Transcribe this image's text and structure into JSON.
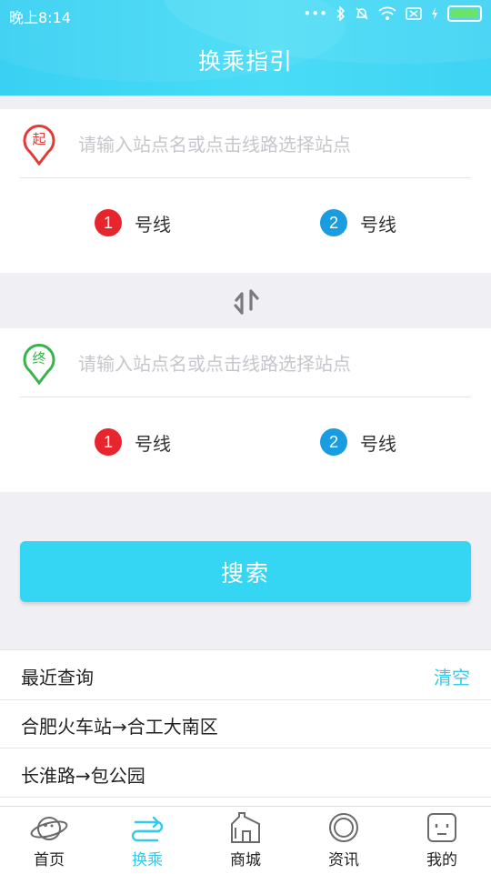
{
  "status_bar": {
    "time": "晚上8:14",
    "icons": [
      "more-icon",
      "bluetooth-icon",
      "mute-icon",
      "wifi-icon",
      "sim-off-icon",
      "charging-icon",
      "battery-icon"
    ]
  },
  "header": {
    "title": "换乘指引"
  },
  "start": {
    "pin_label": "起",
    "placeholder": "请输入站点名或点击线路选择站点",
    "line1": {
      "number": "1",
      "label": "号线"
    },
    "line2": {
      "number": "2",
      "label": "号线"
    }
  },
  "end": {
    "pin_label": "终",
    "placeholder": "请输入站点名或点击线路选择站点",
    "line1": {
      "number": "1",
      "label": "号线"
    },
    "line2": {
      "number": "2",
      "label": "号线"
    }
  },
  "search": {
    "label": "搜索"
  },
  "recent": {
    "title": "最近查询",
    "clear_label": "清空",
    "items": [
      {
        "text": "合肥火车站→合工大南区"
      },
      {
        "text": "长淮路→包公园"
      }
    ]
  },
  "nav": {
    "items": [
      {
        "label": "首页",
        "icon": "planet-icon"
      },
      {
        "label": "换乘",
        "icon": "transfer-icon",
        "active": true
      },
      {
        "label": "商城",
        "icon": "store-icon"
      },
      {
        "label": "资讯",
        "icon": "news-icon"
      },
      {
        "label": "我的",
        "icon": "profile-icon"
      }
    ]
  },
  "colors": {
    "brand": "#34d6f4",
    "start_pin": "#e33a36",
    "end_pin": "#36b34a",
    "line1": "#e8242d",
    "line2": "#1a9de0"
  }
}
